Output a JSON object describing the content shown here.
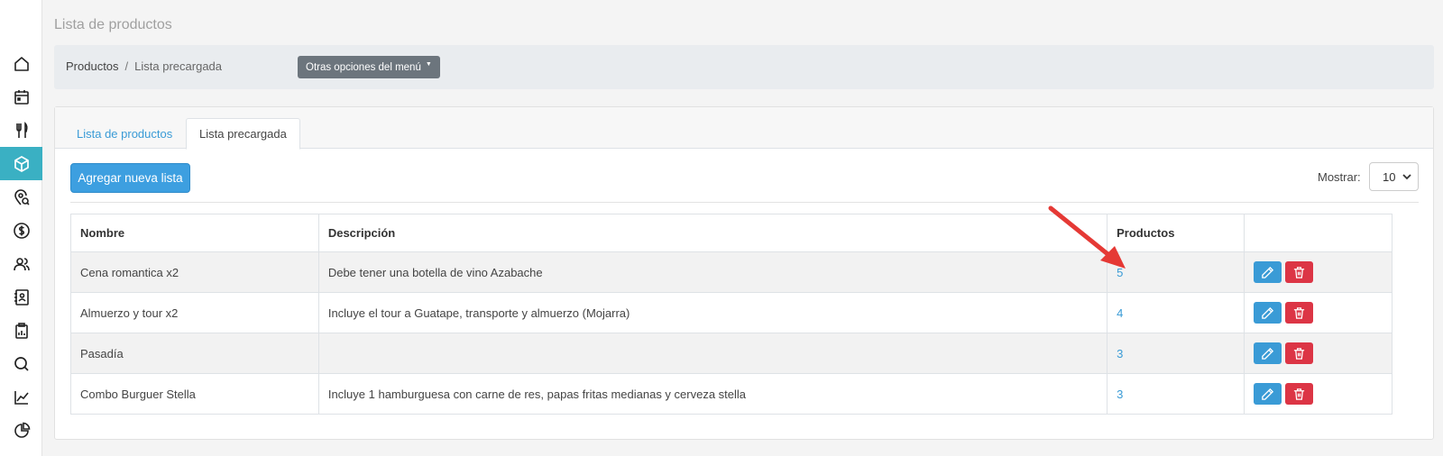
{
  "page_title": "Lista de productos",
  "breadcrumb": {
    "items": [
      "Productos",
      "Lista precargada"
    ],
    "separator": "/"
  },
  "menu_button": {
    "label": "Otras opciones del menú"
  },
  "sidebar": {
    "items": [
      {
        "name": "home",
        "icon": "home-icon"
      },
      {
        "name": "calendar",
        "icon": "calendar-icon"
      },
      {
        "name": "restaurant",
        "icon": "fork-knife-icon"
      },
      {
        "name": "products",
        "icon": "box-icon",
        "active": true
      },
      {
        "name": "location-search",
        "icon": "location-search-icon"
      },
      {
        "name": "payments",
        "icon": "dollar-icon"
      },
      {
        "name": "users",
        "icon": "users-icon"
      },
      {
        "name": "contacts",
        "icon": "contact-book-icon"
      },
      {
        "name": "reports",
        "icon": "clipboard-icon"
      },
      {
        "name": "search",
        "icon": "search-icon"
      },
      {
        "name": "stats",
        "icon": "line-chart-icon"
      },
      {
        "name": "pie",
        "icon": "pie-chart-icon"
      }
    ]
  },
  "tabs": [
    {
      "label": "Lista de productos",
      "active": false
    },
    {
      "label": "Lista precargada",
      "active": true
    }
  ],
  "toolbar": {
    "add_label": "Agregar nueva lista",
    "show_label": "Mostrar:",
    "show_value": "10"
  },
  "table": {
    "headers": [
      "Nombre",
      "Descripción",
      "Productos",
      ""
    ],
    "rows": [
      {
        "name": "Cena romantica x2",
        "description": "Debe tener una botella de vino Azabache",
        "products": "5"
      },
      {
        "name": "Almuerzo y tour x2",
        "description": "Incluye el tour a Guatape, transporte y almuerzo (Mojarra)",
        "products": "4"
      },
      {
        "name": "Pasadía",
        "description": "",
        "products": "3"
      },
      {
        "name": "Combo Burguer Stella",
        "description": "Incluye 1 hamburguesa con carne de res, papas fritas medianas y cerveza stella",
        "products": "3"
      }
    ]
  },
  "colors": {
    "accent": "#3ab0c3",
    "primary": "#3d9fe0",
    "danger": "#dc3545",
    "secondary": "#6c757d",
    "annotation_arrow": "#e53935"
  }
}
